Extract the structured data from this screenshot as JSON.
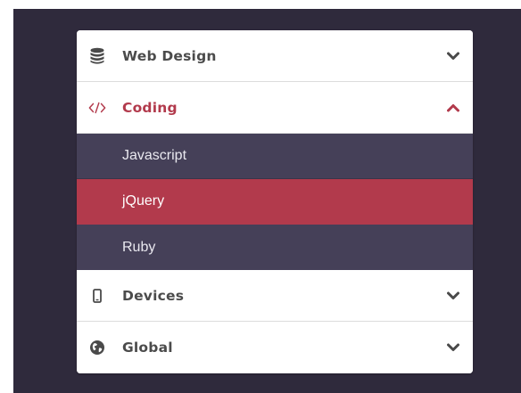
{
  "colors": {
    "background": "#2f2a3c",
    "accent": "#b23a4c",
    "submenu_bg": "#454058",
    "panel_bg": "#ffffff",
    "text": "#4b4b4b"
  },
  "menu": {
    "sections": [
      {
        "label": "Web Design",
        "icon": "database-icon",
        "expanded": false
      },
      {
        "label": "Coding",
        "icon": "code-icon",
        "expanded": true,
        "items": [
          {
            "label": "Javascript",
            "selected": false
          },
          {
            "label": "jQuery",
            "selected": true
          },
          {
            "label": "Ruby",
            "selected": false
          }
        ]
      },
      {
        "label": "Devices",
        "icon": "mobile-icon",
        "expanded": false
      },
      {
        "label": "Global",
        "icon": "globe-icon",
        "expanded": false
      }
    ]
  }
}
